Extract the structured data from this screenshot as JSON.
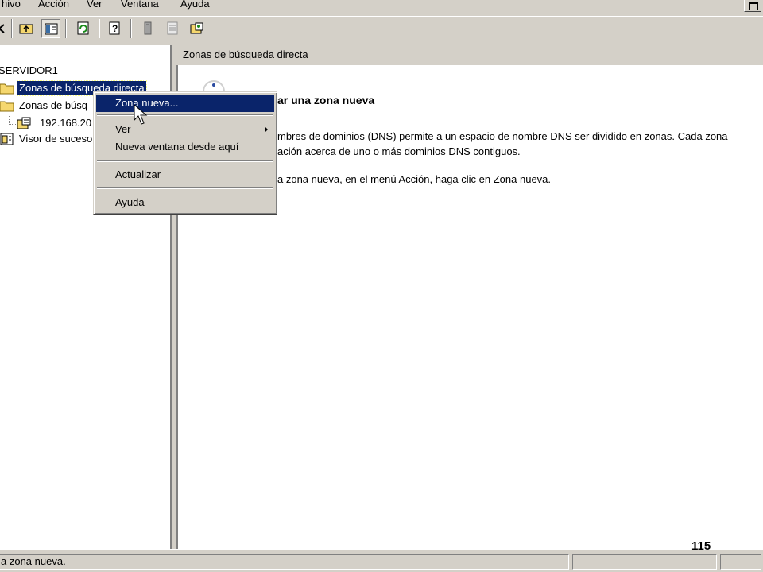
{
  "menubar": {
    "items": [
      {
        "label": "hivo"
      },
      {
        "label": "Acción"
      },
      {
        "label": "Ver"
      },
      {
        "label": "Ventana"
      },
      {
        "label": "Ayuda"
      }
    ]
  },
  "toolbar": {
    "icons": [
      "back-arrow-icon",
      "up-folder-icon",
      "show-hide-tree-icon",
      "refresh-icon",
      "help-icon",
      "server-icon",
      "list-icon",
      "zone-icon"
    ]
  },
  "tree": {
    "root": "SERVIDOR1",
    "nodes": [
      {
        "label": "Zonas de búsqueda directa",
        "icon": "folder-icon",
        "selected": true
      },
      {
        "label": "Zonas de búsq",
        "icon": "folder-icon"
      },
      {
        "label": "192.168.20",
        "icon": "zone-icon"
      },
      {
        "label": "Visor de suceso",
        "icon": "event-viewer-icon"
      }
    ]
  },
  "right_pane": {
    "header": "Zonas de búsqueda directa",
    "heading": "ar una zona nueva",
    "line1": "mbres de dominios (DNS) permite a un espacio de nombre DNS ser dividido en zonas. Cada zona",
    "line2": "ación acerca de uno o más dominios DNS contiguos.",
    "line3": "a zona nueva, en el menú Acción, haga clic en Zona nueva."
  },
  "context_menu": {
    "items": [
      {
        "label": "Zona nueva...",
        "highlighted": true
      },
      {
        "label": "Ver",
        "submenu": true
      },
      {
        "label": "Nueva ventana desde aquí"
      },
      {
        "label": "Actualizar"
      },
      {
        "label": "Ayuda"
      }
    ]
  },
  "statusbar": {
    "text": "a zona nueva."
  },
  "page_number": "115",
  "colors": {
    "face": "#d4d0c8",
    "selection": "#0a246a",
    "window": "#ffffff"
  }
}
